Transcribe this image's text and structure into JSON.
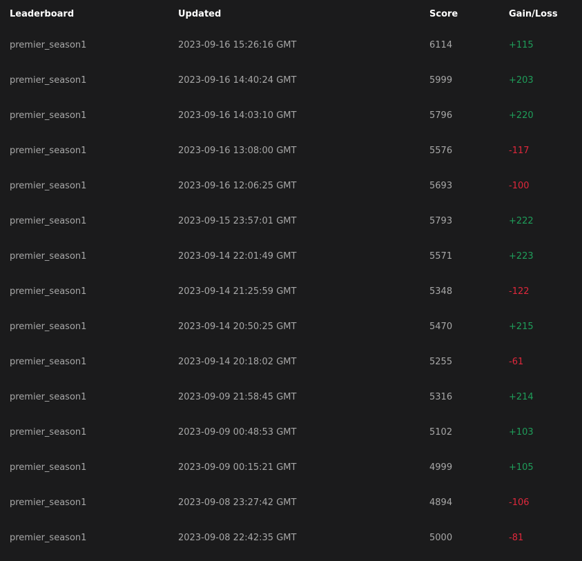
{
  "headers": {
    "leaderboard": "Leaderboard",
    "updated": "Updated",
    "score": "Score",
    "gain_loss": "Gain/Loss"
  },
  "colors": {
    "background": "#1b1b1c",
    "gain": "#1f9e5a",
    "loss": "#e0283c"
  },
  "rows": [
    {
      "leaderboard": "premier_season1",
      "updated": "2023-09-16 15:26:16 GMT",
      "score": "6114",
      "gain": "+115",
      "trend": "gain"
    },
    {
      "leaderboard": "premier_season1",
      "updated": "2023-09-16 14:40:24 GMT",
      "score": "5999",
      "gain": "+203",
      "trend": "gain"
    },
    {
      "leaderboard": "premier_season1",
      "updated": "2023-09-16 14:03:10 GMT",
      "score": "5796",
      "gain": "+220",
      "trend": "gain"
    },
    {
      "leaderboard": "premier_season1",
      "updated": "2023-09-16 13:08:00 GMT",
      "score": "5576",
      "gain": "-117",
      "trend": "loss"
    },
    {
      "leaderboard": "premier_season1",
      "updated": "2023-09-16 12:06:25 GMT",
      "score": "5693",
      "gain": "-100",
      "trend": "loss"
    },
    {
      "leaderboard": "premier_season1",
      "updated": "2023-09-15 23:57:01 GMT",
      "score": "5793",
      "gain": "+222",
      "trend": "gain"
    },
    {
      "leaderboard": "premier_season1",
      "updated": "2023-09-14 22:01:49 GMT",
      "score": "5571",
      "gain": "+223",
      "trend": "gain"
    },
    {
      "leaderboard": "premier_season1",
      "updated": "2023-09-14 21:25:59 GMT",
      "score": "5348",
      "gain": "-122",
      "trend": "loss"
    },
    {
      "leaderboard": "premier_season1",
      "updated": "2023-09-14 20:50:25 GMT",
      "score": "5470",
      "gain": "+215",
      "trend": "gain"
    },
    {
      "leaderboard": "premier_season1",
      "updated": "2023-09-14 20:18:02 GMT",
      "score": "5255",
      "gain": "-61",
      "trend": "loss"
    },
    {
      "leaderboard": "premier_season1",
      "updated": "2023-09-09 21:58:45 GMT",
      "score": "5316",
      "gain": "+214",
      "trend": "gain"
    },
    {
      "leaderboard": "premier_season1",
      "updated": "2023-09-09 00:48:53 GMT",
      "score": "5102",
      "gain": "+103",
      "trend": "gain"
    },
    {
      "leaderboard": "premier_season1",
      "updated": "2023-09-09 00:15:21 GMT",
      "score": "4999",
      "gain": "+105",
      "trend": "gain"
    },
    {
      "leaderboard": "premier_season1",
      "updated": "2023-09-08 23:27:42 GMT",
      "score": "4894",
      "gain": "-106",
      "trend": "loss"
    },
    {
      "leaderboard": "premier_season1",
      "updated": "2023-09-08 22:42:35 GMT",
      "score": "5000",
      "gain": "-81",
      "trend": "loss"
    }
  ]
}
